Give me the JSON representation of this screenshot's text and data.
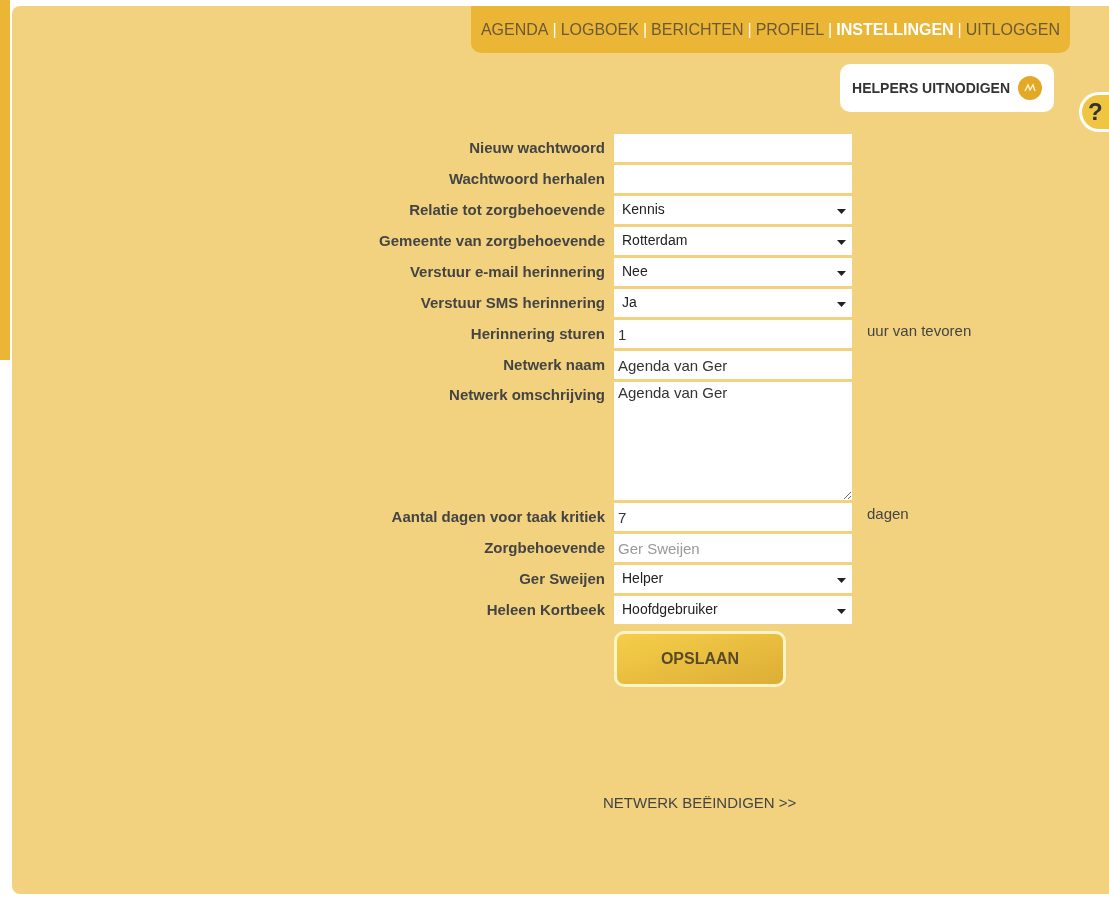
{
  "nav": [
    {
      "label": "AGENDA",
      "selected": false
    },
    {
      "label": "LOGBOEK",
      "selected": false
    },
    {
      "label": "BERICHTEN",
      "selected": false
    },
    {
      "label": "PROFIEL",
      "selected": false
    },
    {
      "label": "INSTELLINGEN",
      "selected": true
    },
    {
      "label": "UITLOGGEN",
      "selected": false
    }
  ],
  "nav_separator": "|",
  "invite_button": "HELPERS UITNODIGEN",
  "help": "?",
  "fields": [
    {
      "label": "Nieuw wachtwoord",
      "kind": "text"
    },
    {
      "label": "Wachtwoord herhalen",
      "kind": "text"
    },
    {
      "label": "Relatie tot zorgbehoevende",
      "kind": "select",
      "value": "Kennis"
    },
    {
      "label": "Gemeente van zorgbehoevende",
      "kind": "select",
      "value": "Rotterdam"
    },
    {
      "label": "Verstuur e-mail herinnering",
      "kind": "select",
      "value": "Nee"
    },
    {
      "label": "Verstuur SMS herinnering",
      "kind": "select",
      "value": "Ja"
    },
    {
      "label": "Herinnering sturen",
      "kind": "text",
      "value": "1",
      "suffix": "uur van tevoren"
    },
    {
      "label": "Netwerk naam",
      "kind": "text",
      "value": "Agenda van Ger"
    },
    {
      "label": "Netwerk omschrijving",
      "kind": "textarea",
      "value": "Agenda van Ger"
    },
    {
      "label": "Aantal dagen voor taak kritiek",
      "kind": "text",
      "value": "7",
      "suffix": "dagen"
    },
    {
      "label": "Zorgbehoevende",
      "kind": "readonly",
      "value": "Ger Sweijen"
    },
    {
      "label": "Ger Sweijen",
      "kind": "select",
      "value": "Helper"
    },
    {
      "label": "Heleen Kortbeek",
      "kind": "select",
      "value": "Hoofdgebruiker"
    }
  ],
  "save_button": "OPSLAAN",
  "end_link": "NETWERK BEËINDIGEN >>"
}
